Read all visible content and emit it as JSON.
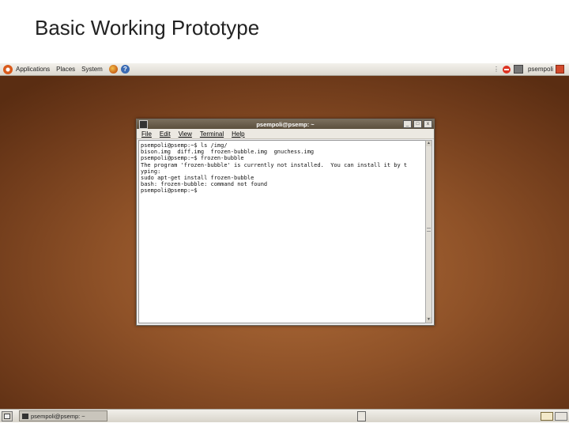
{
  "slide": {
    "title": "Basic Working Prototype"
  },
  "top_panel": {
    "menus": [
      "Applications",
      "Places",
      "System"
    ],
    "user": "psempoli"
  },
  "terminal": {
    "title": "psempoli@psemp: ~",
    "window_buttons": [
      "_",
      "□",
      "x"
    ],
    "menus": [
      "File",
      "Edit",
      "View",
      "Terminal",
      "Help"
    ],
    "lines": [
      "psempoli@psemp:~$ ls /img/",
      "bison.img  diff.img  frozen-bubble.img  gnuchess.img",
      "psempoli@psemp:~$ frozen-bubble",
      "The program 'frozen-bubble' is currently not installed.  You can install it by t",
      "yping:",
      "sudo apt-get install frozen-bubble",
      "bash: frozen-bubble: command not found",
      "psempoli@psemp:~$"
    ]
  },
  "bottom_panel": {
    "task_label": "psempoli@psemp: ~"
  }
}
